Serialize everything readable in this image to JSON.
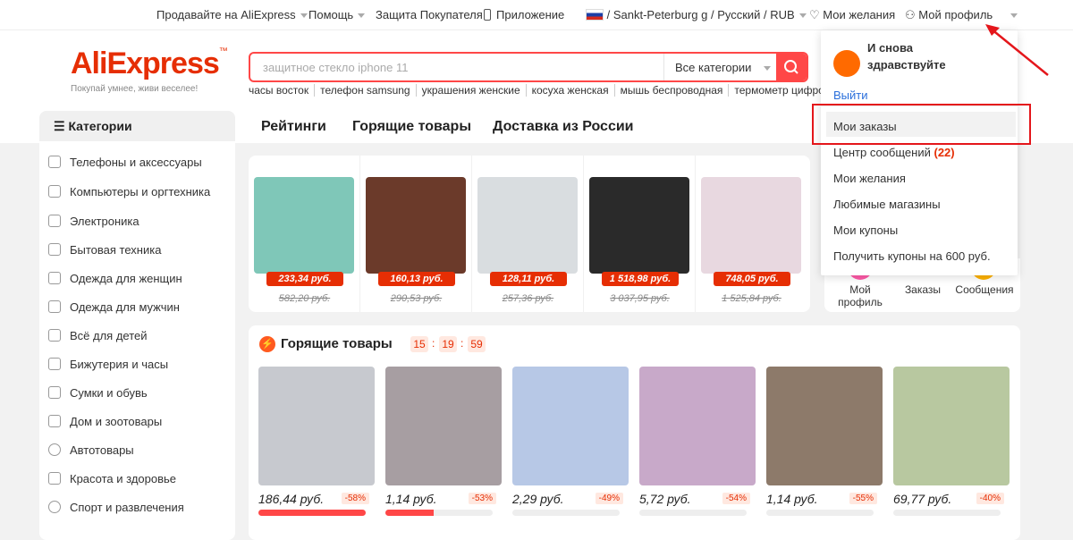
{
  "topbar": {
    "sell": "Продавайте на AliExpress",
    "help": "Помощь",
    "protection": "Защита Покупателя",
    "app": "Приложение",
    "locale": "/ Sankt-Peterburg g / Русский / RUB",
    "wishlist": "Мои желания",
    "profile": "Мой профиль"
  },
  "header": {
    "logo": "AliExpress",
    "slogan": "Покупай умнее, живи веселее!",
    "search_placeholder": "защитное стекло iphone 11",
    "search_category": "Все категории",
    "hotwords": [
      "часы восток",
      "телефон samsung",
      "украшения женские",
      "косуха женская",
      "мышь беспроводная",
      "термометр цифрово"
    ],
    "nav": [
      "Рейтинги",
      "Горящие товары",
      "Доставка из России"
    ]
  },
  "categories": {
    "title": "Категории",
    "items": [
      "Телефоны и аксессуары",
      "Компьютеры и оргтехника",
      "Электроника",
      "Бытовая техника",
      "Одежда для женщин",
      "Одежда для мужчин",
      "Всё для детей",
      "Бижутерия и часы",
      "Сумки и обувь",
      "Дом и зоотовары",
      "Автотовары",
      "Красота и здоровье",
      "Спорт и развлечения"
    ]
  },
  "strip": [
    {
      "price": "233,34 руб.",
      "old": "582,20 руб.",
      "color": "#7fc7b8"
    },
    {
      "price": "160,13 руб.",
      "old": "290,53 руб.",
      "color": "#6b3a2a"
    },
    {
      "price": "128,11 руб.",
      "old": "257,36 руб.",
      "color": "#d9dde0"
    },
    {
      "price": "1 518,98 руб.",
      "old": "3 037,95 руб.",
      "color": "#2a2a2a"
    },
    {
      "price": "748,05 руб.",
      "old": "1 525,84 руб.",
      "color": "#e8d8e0"
    }
  ],
  "hot": {
    "title": "Горящие товары",
    "timer": [
      "15",
      "19",
      "59"
    ],
    "items": [
      {
        "price": "186,44 руб.",
        "discount": "-58%",
        "progress": 1.0,
        "color": "#c7c9cf"
      },
      {
        "price": "1,14 руб.",
        "discount": "-53%",
        "progress": 0.45,
        "color": "#a79ea2"
      },
      {
        "price": "2,29 руб.",
        "discount": "-49%",
        "progress": 0.0,
        "color": "#b7c8e6"
      },
      {
        "price": "5,72 руб.",
        "discount": "-54%",
        "progress": 0.0,
        "color": "#c8a9c9"
      },
      {
        "price": "1,14 руб.",
        "discount": "-55%",
        "progress": 0.0,
        "color": "#8d7a6a"
      },
      {
        "price": "69,77 руб.",
        "discount": "-40%",
        "progress": 0.0,
        "color": "#b8c8a0"
      }
    ]
  },
  "right_panel": {
    "items": [
      "Мой профиль",
      "Заказы",
      "Сообщения"
    ]
  },
  "dropdown": {
    "greeting": "И снова здравствуйте",
    "logout": "Выйти",
    "items": [
      {
        "label": "Мои заказы",
        "badge": ""
      },
      {
        "label": "Центр сообщений",
        "badge": "(22)"
      },
      {
        "label": "Мои желания",
        "badge": ""
      },
      {
        "label": "Любимые магазины",
        "badge": ""
      },
      {
        "label": "Мои купоны",
        "badge": ""
      },
      {
        "label": "Получить купоны на 600 руб.",
        "badge": ""
      }
    ]
  },
  "colors": {
    "accent": "#ff4747",
    "brand": "#e62e04",
    "annotation": "#e4161b"
  }
}
